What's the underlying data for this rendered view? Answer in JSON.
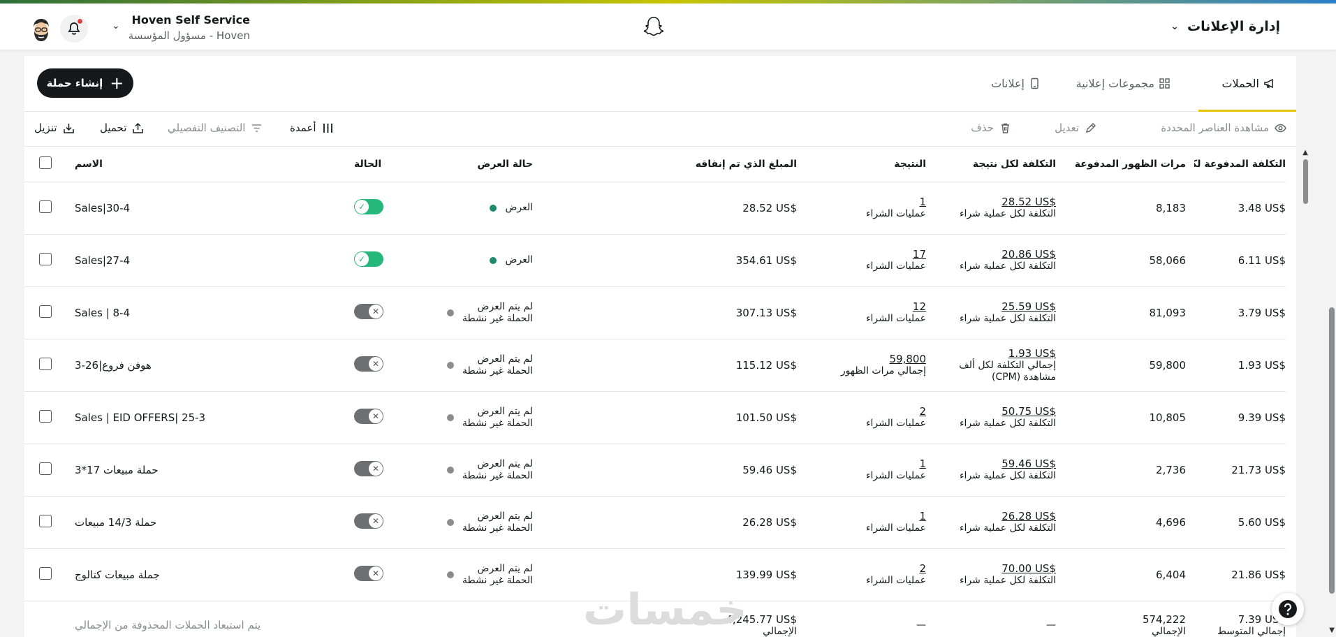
{
  "header": {
    "app_menu": "إدارة الإعلانات",
    "account_name": "Hoven Self Service",
    "account_role": "Hoven - مسؤول المؤسسة"
  },
  "tabs": [
    {
      "label": "الحملات",
      "icon": "megaphone-icon",
      "active": true
    },
    {
      "label": "مجموعات إعلانية",
      "icon": "grid-icon",
      "active": false
    },
    {
      "label": "إعلانات",
      "icon": "phone-icon",
      "active": false
    }
  ],
  "create_button": "إنشاء حملة",
  "toolbar": {
    "view_selected": "مشاهدة العناصر المحددة",
    "edit": "تعديل",
    "delete": "حذف",
    "columns": "أعمدة",
    "breakdown": "التصنيف التفصيلي",
    "upload": "تحميل",
    "download": "تنزيل"
  },
  "columns": {
    "name": "الاسم",
    "status": "الحالة",
    "delivery": "حالة العرض",
    "spend": "المبلغ الذي تم إنفاقه",
    "result": "النتيجة",
    "cost_per_result": "التكلفة لكل نتيجة",
    "paid_impressions": "مرات الظهور المدفوعة",
    "ecpm": "التكلفة المدفوعة لكل ألف ظهور"
  },
  "rows": [
    {
      "name": "Sales|30-4",
      "on": true,
      "delivery_1": "العرض",
      "delivery_2": "",
      "spend": "28.52 US$",
      "result": "1",
      "result_label": "عمليات الشراء",
      "cpr": "28.52 US$",
      "cpr_label": "التكلفة لكل عملية شراء",
      "impressions": "8,183",
      "ecpm": "3.48 US$"
    },
    {
      "name": "Sales|27-4",
      "on": true,
      "delivery_1": "العرض",
      "delivery_2": "",
      "spend": "354.61 US$",
      "result": "17",
      "result_label": "عمليات الشراء",
      "cpr": "20.86 US$",
      "cpr_label": "التكلفة لكل عملية شراء",
      "impressions": "58,066",
      "ecpm": "6.11 US$"
    },
    {
      "name": "Sales | 8-4",
      "on": false,
      "delivery_1": "لم يتم العرض",
      "delivery_2": "الحملة غير نشطة",
      "spend": "307.13 US$",
      "result": "12",
      "result_label": "عمليات الشراء",
      "cpr": "25.59 US$",
      "cpr_label": "التكلفة لكل عملية شراء",
      "impressions": "81,093",
      "ecpm": "3.79 US$"
    },
    {
      "name": "هوفن فروع|26-3",
      "on": false,
      "delivery_1": "لم يتم العرض",
      "delivery_2": "الحملة غير نشطة",
      "spend": "115.12 US$",
      "result": "59,800",
      "result_label": "إجمالي مرات الظهور",
      "cpr": "1.93 US$",
      "cpr_label": "إجمالي التكلفة لكل ألف مشاهدة (CPM)",
      "impressions": "59,800",
      "ecpm": "1.93 US$"
    },
    {
      "name": "Sales | EID OFFERS| 25-3",
      "on": false,
      "delivery_1": "لم يتم العرض",
      "delivery_2": "الحملة غير نشطة",
      "spend": "101.50 US$",
      "result": "2",
      "result_label": "عمليات الشراء",
      "cpr": "50.75 US$",
      "cpr_label": "التكلفة لكل عملية شراء",
      "impressions": "10,805",
      "ecpm": "9.39 US$"
    },
    {
      "name": "حملة مبيعات 17*3",
      "on": false,
      "delivery_1": "لم يتم العرض",
      "delivery_2": "الحملة غير نشطة",
      "spend": "59.46 US$",
      "result": "1",
      "result_label": "عمليات الشراء",
      "cpr": "59.46 US$",
      "cpr_label": "التكلفة لكل عملية شراء",
      "impressions": "2,736",
      "ecpm": "21.73 US$"
    },
    {
      "name": "حملة 14/3 مبيعات",
      "on": false,
      "delivery_1": "لم يتم العرض",
      "delivery_2": "الحملة غير نشطة",
      "spend": "26.28 US$",
      "result": "1",
      "result_label": "عمليات الشراء",
      "cpr": "26.28 US$",
      "cpr_label": "التكلفة لكل عملية شراء",
      "impressions": "4,696",
      "ecpm": "5.60 US$"
    },
    {
      "name": "جملة مبيعات كتالوج",
      "on": false,
      "delivery_1": "لم يتم العرض",
      "delivery_2": "الحملة غير نشطة",
      "spend": "139.99 US$",
      "result": "2",
      "result_label": "عمليات الشراء",
      "cpr": "70.00 US$",
      "cpr_label": "التكلفة لكل عملية شراء",
      "impressions": "6,404",
      "ecpm": "21.86 US$"
    }
  ],
  "footer": {
    "note": "يتم استبعاد الحملات المحذوفة من الإجمالي",
    "spend": "4,245.77 US$",
    "spend_label": "الإجمالي",
    "result": "—",
    "cpr": "—",
    "impressions": "574,222",
    "impressions_label": "الإجمالي",
    "ecpm": "7.39 US$",
    "ecpm_label": "إجمالي المتوسط"
  },
  "watermark": "خمسات",
  "colors": {
    "accent": "#e3c400",
    "active_toggle": "#26b87a",
    "delivering_dot": "#1f8a6e",
    "inactive_dot": "#8a8d90"
  }
}
